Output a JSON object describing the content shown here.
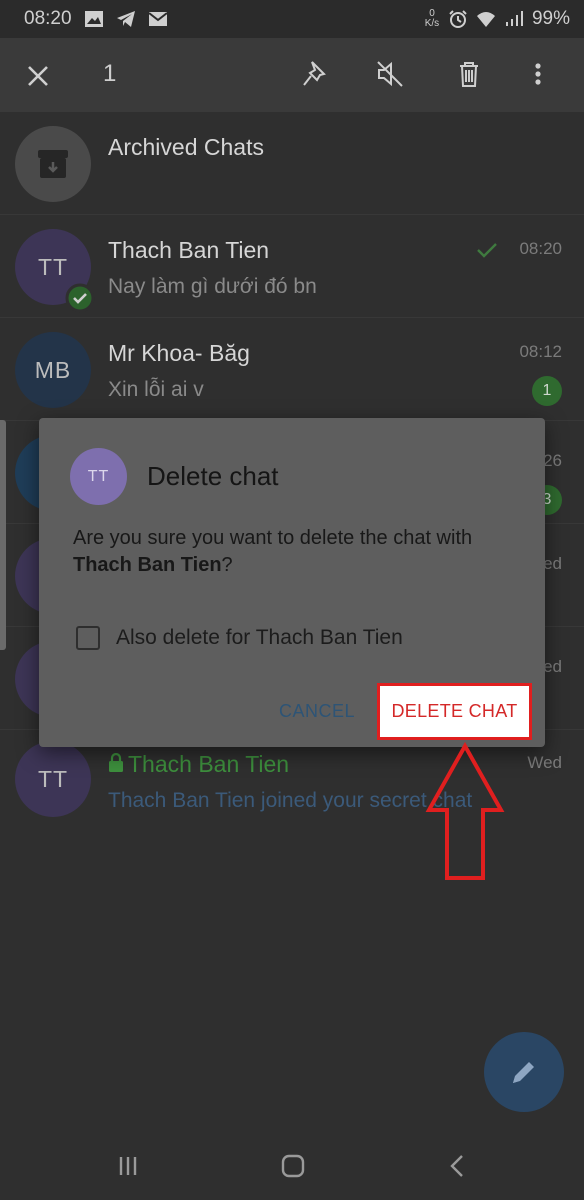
{
  "status": {
    "time": "08:20",
    "net_top": "0",
    "net_unit": "K/s",
    "battery": "99%"
  },
  "action_bar": {
    "selected_count": "1",
    "icons": [
      "close-icon",
      "pin-icon",
      "mute-icon",
      "trash-icon",
      "more-vert-icon"
    ]
  },
  "chats": [
    {
      "avatar": "",
      "name": "Archived Chats",
      "message": "",
      "time": ""
    },
    {
      "avatar": "TT",
      "name": "Thach Ban Tien",
      "message": "Nay làm gì dưới đó bn",
      "time": "08:20"
    },
    {
      "avatar": "MB",
      "name": "Mr Khoa- Băg",
      "message": "Xin lỗi ai v",
      "time": "08:12",
      "unread": "1"
    },
    {
      "avatar": "TT",
      "name": "Thach Ban Tien",
      "message": "Thach Ban Tien joined your secret chat",
      "time": "Wed"
    }
  ],
  "partial_times": {
    "row3": "26",
    "row3_unread": "3",
    "row4": "ed",
    "row5": "ed"
  },
  "dialog": {
    "avatar": "TT",
    "title": "Delete chat",
    "message_prefix": "Are you sure you want to delete the chat with ",
    "message_name": "Thach Ban Tien",
    "message_suffix": "?",
    "checkbox_label": "Also delete for Thach Ban Tien",
    "cancel": "CANCEL",
    "delete": "DELETE CHAT"
  },
  "colors": {
    "accent_red": "#e01f1f",
    "secret_green": "#3d8f3d",
    "link_blue": "#2d5476"
  }
}
